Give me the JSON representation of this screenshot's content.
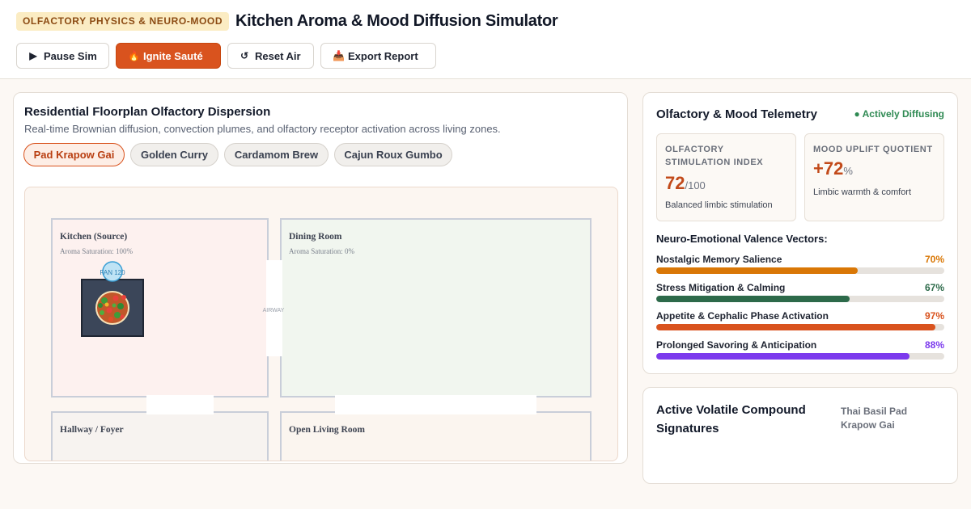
{
  "header": {
    "badge": "OLFACTORY PHYSICS & NEURO-MOOD",
    "title": "Kitchen Aroma & Mood Diffusion Simulator"
  },
  "toolbar": [
    {
      "label": "Pause Sim",
      "icon": "play-icon",
      "glyph": "▶"
    },
    {
      "label": "Ignite Sauté",
      "icon": "fire-icon",
      "glyph": "🔥"
    },
    {
      "label": "Reset Air",
      "icon": "reset-icon",
      "glyph": "↺"
    },
    {
      "label": "Export Report",
      "icon": "export-icon",
      "glyph": "📥"
    }
  ],
  "floorplan": {
    "title": "Residential Floorplan Olfactory Dispersion",
    "subtitle": "Real-time Brownian diffusion, convection plumes, and olfactory receptor activation across living zones.",
    "recipes": [
      "Pad Krapow Gai",
      "Golden Curry",
      "Cardamom Brew",
      "Cajun Roux Gumbo"
    ],
    "active_recipe_index": 0,
    "rooms": [
      {
        "name": "Kitchen (Source)",
        "saturation": "Aroma Saturation: 100%"
      },
      {
        "name": "Dining Room",
        "saturation": "Aroma Saturation: 0%"
      },
      {
        "name": "Hallway / Foyer"
      },
      {
        "name": "Open Living Room"
      }
    ],
    "fan_label": "FAN 120",
    "airway_label": "AIRWAY"
  },
  "telemetry": {
    "title": "Olfactory & Mood Telemetry",
    "status": "● Actively Diffusing",
    "metrics": [
      {
        "label": "OLFACTORY STIMULATION INDEX",
        "value": "72",
        "unit": "/100",
        "desc": "Balanced limbic stimulation"
      },
      {
        "label": "MOOD UPLIFT QUOTIENT",
        "value": "+72",
        "unit": "%",
        "desc": "Limbic warmth & comfort"
      }
    ],
    "vectors_title": "Neuro-Emotional Valence Vectors:",
    "vectors": [
      {
        "name": "Nostalgic Memory Salience",
        "pct": "70%",
        "value": 70,
        "color": "#d97706"
      },
      {
        "name": "Stress Mitigation & Calming",
        "pct": "67%",
        "value": 67,
        "color": "#2d6a4a"
      },
      {
        "name": "Appetite & Cephalic Phase Activation",
        "pct": "97%",
        "value": 97,
        "color": "#d9531e"
      },
      {
        "name": "Prolonged Savoring & Anticipation",
        "pct": "88%",
        "value": 88,
        "color": "#7c3aed"
      }
    ]
  },
  "voc": {
    "title": "Active Volatile Compound Signatures",
    "recipe": "Thai Basil Pad Krapow Gai"
  }
}
